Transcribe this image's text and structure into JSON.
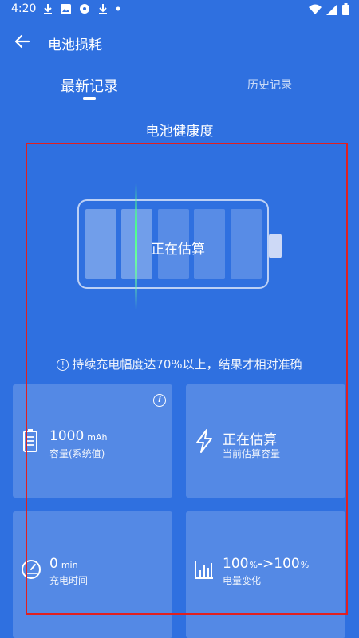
{
  "status_bar": {
    "time": "4:20",
    "left_icons": [
      "download-icon",
      "image-icon",
      "flower-icon",
      "download-icon",
      "dot-icon"
    ],
    "right_icons": [
      "wifi-icon",
      "signal-icon",
      "battery-icon"
    ]
  },
  "header": {
    "title": "电池损耗",
    "back_icon": "arrow-left-icon"
  },
  "tabs": [
    {
      "label": "最新记录",
      "active": true
    },
    {
      "label": "历史记录",
      "active": false
    }
  ],
  "section_title": "电池健康度",
  "battery": {
    "status_text": "正在估算",
    "cells_total": 5,
    "cells_filled": 2
  },
  "notice": {
    "icon": "exclamation-circle-icon",
    "text": "持续充电幅度达70%以上，结果才相对准确"
  },
  "cards": [
    {
      "icon": "battery-list-icon",
      "value": "1000",
      "unit": "mAh",
      "label": "容量(系统值)",
      "info_icon": "info-icon"
    },
    {
      "icon": "lightning-icon",
      "value": "正在估算",
      "unit": "",
      "label": "当前估算容量"
    },
    {
      "icon": "speedometer-icon",
      "value": "0",
      "unit": "min",
      "label": "充电时间"
    },
    {
      "icon": "bar-chart-icon",
      "value_parts": [
        "100",
        "%",
        "->100",
        "%"
      ],
      "label": "电量变化"
    }
  ],
  "colors": {
    "background": "#2f70e0",
    "scan_line": "#4cff8a",
    "highlight": "#e02020"
  }
}
